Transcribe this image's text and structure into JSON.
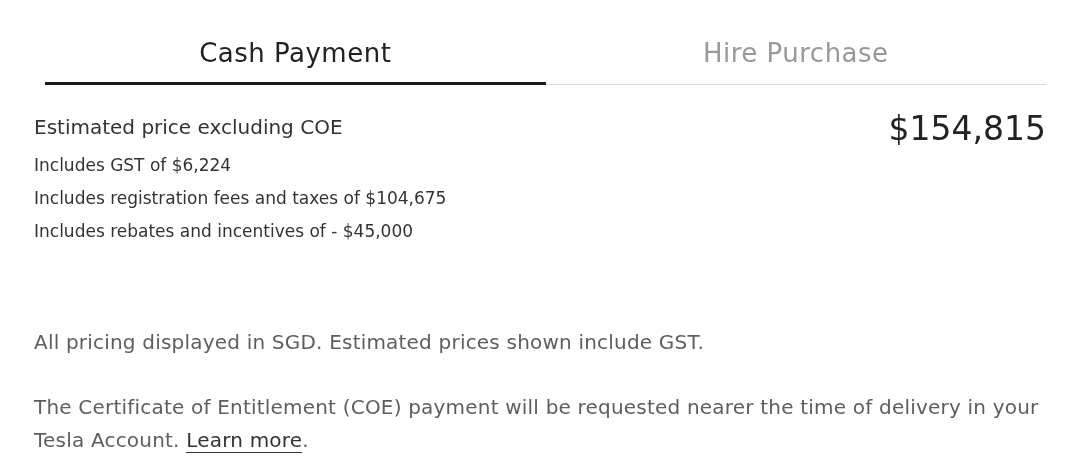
{
  "tabs": [
    {
      "label": "Cash Payment",
      "selected": true
    },
    {
      "label": "Hire Purchase",
      "selected": false
    }
  ],
  "price": {
    "label": "Estimated price excluding COE",
    "amount": "$154,815",
    "details": [
      "Includes GST of $6,224",
      "Includes registration fees and taxes of $104,675",
      "Includes rebates and incentives of - $45,000"
    ]
  },
  "pricing_note": "All pricing displayed in SGD. Estimated prices shown include GST.",
  "coe_note": {
    "text": "The Certificate of Entitlement (COE) payment will be requested nearer the time of delivery in your Tesla Account.",
    "link": "Learn more",
    "after": "."
  }
}
